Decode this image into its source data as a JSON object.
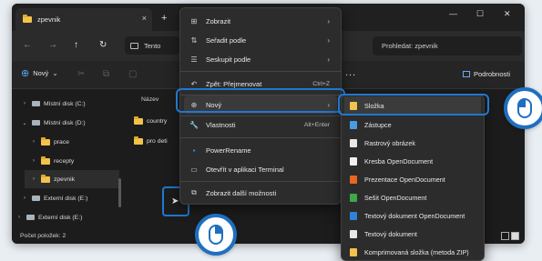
{
  "window": {
    "tab_title": "zpevnik",
    "tab_close": "×",
    "new_tab": "+",
    "minimize": "—",
    "maximize": "☐",
    "close": "✕"
  },
  "address": {
    "back": "←",
    "forward": "→",
    "up": "↑",
    "refresh": "↻",
    "location_text": "Tento",
    "search_placeholder": "Prohledat: zpevnik"
  },
  "toolbar": {
    "new_label": "Nový",
    "new_dropdown": "⌄",
    "more_label": "...",
    "details_label": "Podrobnosti"
  },
  "sidebar": {
    "items": [
      {
        "label": "Místní disk (C:)",
        "chevron": "›"
      },
      {
        "label": "Místní disk (D:)",
        "chevron": "⌄"
      },
      {
        "label": "prace",
        "chevron": "›"
      },
      {
        "label": "recepty",
        "chevron": "›"
      },
      {
        "label": "zpevnik",
        "chevron": "›"
      },
      {
        "label": "Externí disk (E:)",
        "chevron": "›"
      },
      {
        "label": "Externí disk (E:)",
        "chevron": "›"
      }
    ]
  },
  "content": {
    "column_name": "Název",
    "files": [
      "country",
      "pro deti"
    ]
  },
  "status": {
    "text": "Počet položek: 2"
  },
  "context_menu": {
    "items": [
      {
        "label": "Zobrazit",
        "icon": "grid-icon",
        "glyph": "⊞",
        "arrow": "›"
      },
      {
        "label": "Seřadit podle",
        "icon": "sort-icon",
        "glyph": "⇅",
        "arrow": "›"
      },
      {
        "label": "Seskupit podle",
        "icon": "group-icon",
        "glyph": "☰",
        "arrow": "›"
      },
      {
        "label": "Zpět: Přejmenovat",
        "icon": "undo-icon",
        "glyph": "↶",
        "shortcut": "Ctrl+Z"
      },
      {
        "label": "Nový",
        "icon": "new-icon",
        "glyph": "⊕",
        "arrow": "›"
      },
      {
        "label": "Vlastnosti",
        "icon": "wrench-icon",
        "glyph": "🔧",
        "shortcut": "Alt+Enter"
      },
      {
        "label": "PowerRename",
        "icon": "powerrename-icon",
        "glyph": "▪"
      },
      {
        "label": "Otevřít v aplikaci Terminal",
        "icon": "terminal-icon",
        "glyph": "▭"
      },
      {
        "label": "Zobrazit další možnosti",
        "icon": "more-options-icon",
        "glyph": "⧉"
      }
    ]
  },
  "submenu": {
    "items": [
      {
        "label": "Složka",
        "icon": "folder-icon",
        "color": "#f3c24b"
      },
      {
        "label": "Zástupce",
        "icon": "shortcut-icon",
        "color": "#4a9be0"
      },
      {
        "label": "Rastrový obrázek",
        "icon": "bitmap-icon",
        "color": "#e8e8e8"
      },
      {
        "label": "Kresba OpenDocument",
        "icon": "odg-icon",
        "color": "#f0f0f0"
      },
      {
        "label": "Prezentace OpenDocument",
        "icon": "odp-icon",
        "color": "#e8661f"
      },
      {
        "label": "Sešit OpenDocument",
        "icon": "ods-icon",
        "color": "#3fa84a"
      },
      {
        "label": "Textový dokument OpenDocument",
        "icon": "odt-icon",
        "color": "#2f83d6"
      },
      {
        "label": "Textový dokument",
        "icon": "txt-icon",
        "color": "#e8e8e8"
      },
      {
        "label": "Komprimovaná složka (metoda ZIP)",
        "icon": "zip-icon",
        "color": "#f3c24b"
      }
    ]
  }
}
